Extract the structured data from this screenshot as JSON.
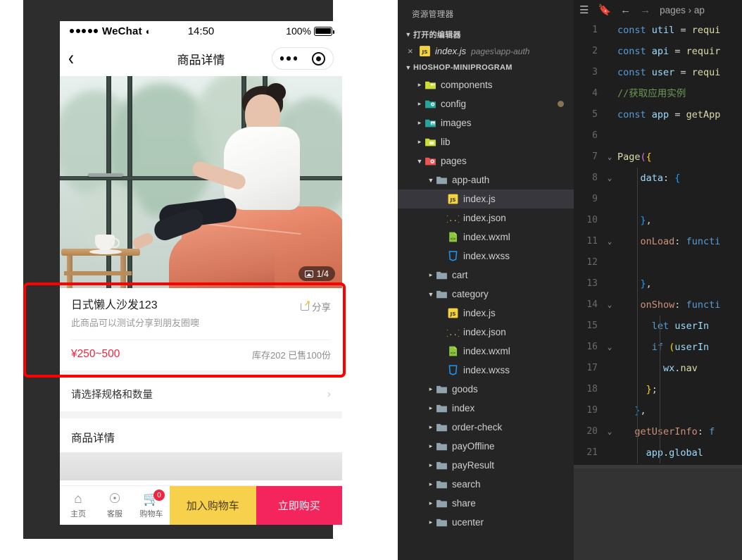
{
  "simulator": {
    "status_bar": {
      "carrier": "WeChat",
      "time": "14:50",
      "battery": "100%"
    },
    "nav": {
      "back_icon": "chevron-left-icon",
      "title": "商品详情",
      "more_icon": "more-dots-icon",
      "target_icon": "capsule-target-icon"
    },
    "hero": {
      "carousel_counter": "1/4"
    },
    "product": {
      "title": "日式懒人沙发123",
      "description": "此商品可以测试分享到朋友圈噢",
      "share_label": "分享",
      "price": "¥250~500",
      "stock": "库存202  已售100份",
      "price_color": "#f0253f"
    },
    "spec_row": {
      "label": "请选择规格和数量",
      "chevron": "›"
    },
    "detail_section": {
      "title": "商品详情"
    },
    "bottom_bar": {
      "items": [
        {
          "icon": "home-icon",
          "glyph": "⌂",
          "label": "主页"
        },
        {
          "icon": "service-chat-icon",
          "glyph": "☺",
          "label": "客服"
        },
        {
          "icon": "cart-icon",
          "glyph": "🛒",
          "label": "购物车",
          "badge": "0"
        }
      ],
      "add_cart_label": "加入购物车",
      "buy_now_label": "立即购买",
      "add_cart_color": "#f8d14c",
      "buy_now_color": "#f4255c"
    },
    "annotation": {
      "type": "red-rectangle",
      "color": "#fe0000"
    }
  },
  "explorer": {
    "title": "资源管理器",
    "open_editors": {
      "label": "打开的编辑器",
      "items": [
        {
          "close": "×",
          "icon": "js-file-icon",
          "name": "index.js",
          "path": "pages\\app-auth"
        }
      ]
    },
    "project": {
      "label": "HIOSHOP-MINIPROGRAM",
      "tree": [
        {
          "depth": 1,
          "type": "folder",
          "icon": "folder-components-icon",
          "name": "components",
          "expanded": false
        },
        {
          "depth": 1,
          "type": "folder",
          "icon": "folder-config-icon",
          "name": "config",
          "expanded": false,
          "dirty": true
        },
        {
          "depth": 1,
          "type": "folder",
          "icon": "folder-images-icon",
          "name": "images",
          "expanded": false
        },
        {
          "depth": 1,
          "type": "folder",
          "icon": "folder-lib-icon",
          "name": "lib",
          "expanded": false
        },
        {
          "depth": 1,
          "type": "folder",
          "icon": "folder-pages-icon",
          "name": "pages",
          "expanded": true
        },
        {
          "depth": 2,
          "type": "folder",
          "icon": "folder-icon",
          "name": "app-auth",
          "expanded": true
        },
        {
          "depth": 3,
          "type": "file",
          "icon": "js-file-icon",
          "name": "index.js",
          "selected": true
        },
        {
          "depth": 3,
          "type": "file",
          "icon": "json-file-icon",
          "name": "index.json"
        },
        {
          "depth": 3,
          "type": "file",
          "icon": "wxml-file-icon",
          "name": "index.wxml"
        },
        {
          "depth": 3,
          "type": "file",
          "icon": "wxss-file-icon",
          "name": "index.wxss"
        },
        {
          "depth": 2,
          "type": "folder",
          "icon": "folder-icon",
          "name": "cart",
          "expanded": false
        },
        {
          "depth": 2,
          "type": "folder",
          "icon": "folder-icon",
          "name": "category",
          "expanded": true
        },
        {
          "depth": 3,
          "type": "file",
          "icon": "js-file-icon",
          "name": "index.js"
        },
        {
          "depth": 3,
          "type": "file",
          "icon": "json-file-icon",
          "name": "index.json"
        },
        {
          "depth": 3,
          "type": "file",
          "icon": "wxml-file-icon",
          "name": "index.wxml"
        },
        {
          "depth": 3,
          "type": "file",
          "icon": "wxss-file-icon",
          "name": "index.wxss"
        },
        {
          "depth": 2,
          "type": "folder",
          "icon": "folder-icon",
          "name": "goods",
          "expanded": false
        },
        {
          "depth": 2,
          "type": "folder",
          "icon": "folder-icon",
          "name": "index",
          "expanded": false
        },
        {
          "depth": 2,
          "type": "folder",
          "icon": "folder-icon",
          "name": "order-check",
          "expanded": false
        },
        {
          "depth": 2,
          "type": "folder",
          "icon": "folder-icon",
          "name": "payOffline",
          "expanded": false
        },
        {
          "depth": 2,
          "type": "folder",
          "icon": "folder-icon",
          "name": "payResult",
          "expanded": false
        },
        {
          "depth": 2,
          "type": "folder",
          "icon": "folder-icon",
          "name": "search",
          "expanded": false
        },
        {
          "depth": 2,
          "type": "folder",
          "icon": "folder-icon",
          "name": "share",
          "expanded": false
        },
        {
          "depth": 2,
          "type": "folder",
          "icon": "folder-icon",
          "name": "ucenter",
          "expanded": false
        }
      ]
    }
  },
  "code_editor": {
    "breadcrumb": {
      "list_icon": "outline-list-icon",
      "bookmark_icon": "bookmark-icon",
      "back_icon": "arrow-left-icon",
      "forward_icon": "arrow-right-icon",
      "path": "pages › ap"
    },
    "lines": [
      {
        "n": "1",
        "fold": "",
        "html": "<span class='kw'>const</span> <span class='var'>util</span> <span class='op'>=</span> <span class='fn'>requi</span>"
      },
      {
        "n": "2",
        "fold": "",
        "html": "<span class='kw'>const</span> <span class='var'>api</span> <span class='op'>=</span> <span class='fn'>requir</span>"
      },
      {
        "n": "3",
        "fold": "",
        "html": "<span class='kw'>const</span> <span class='var'>user</span> <span class='op'>=</span> <span class='fn'>requi</span>"
      },
      {
        "n": "4",
        "fold": "",
        "html": "<span class='cm'>//获取应用实例</span>"
      },
      {
        "n": "5",
        "fold": "",
        "html": "<span class='kw'>const</span> <span class='var'>app</span> <span class='op'>=</span> <span class='fn'>getApp</span>"
      },
      {
        "n": "6",
        "fold": "",
        "html": ""
      },
      {
        "n": "7",
        "fold": "v",
        "html": "<span class='fn'>Page</span><span class='br2'>(</span><span class='br1'>{</span>"
      },
      {
        "n": "8",
        "fold": "v",
        "html": "    <span class='var'>data</span><span class='op'>: </span><span class='br3'>{</span>"
      },
      {
        "n": "9",
        "fold": "",
        "html": ""
      },
      {
        "n": "10",
        "fold": "",
        "html": "    <span class='br3'>}</span><span class='op'>,</span>"
      },
      {
        "n": "11",
        "fold": "v",
        "html": "    <span class='pr'>onLoad</span><span class='op'>: </span><span class='kw'>functi</span>"
      },
      {
        "n": "12",
        "fold": "",
        "html": ""
      },
      {
        "n": "13",
        "fold": "",
        "html": "    <span class='br3'>}</span><span class='op'>,</span>"
      },
      {
        "n": "14",
        "fold": "v",
        "html": "    <span class='pr'>onShow</span><span class='op'>: </span><span class='kw'>functi</span>"
      },
      {
        "n": "15",
        "fold": "",
        "html": "      <span class='kw'>let</span> <span class='var'>userIn</span>"
      },
      {
        "n": "16",
        "fold": "v",
        "html": "      <span class='kw'>if</span> <span class='br1'>(</span><span class='var'>userIn</span>"
      },
      {
        "n": "17",
        "fold": "",
        "html": "        <span class='var'>wx</span><span class='op'>.</span><span class='fn'>nav</span>"
      },
      {
        "n": "18",
        "fold": "",
        "html": "     <span class='br1'>}</span><span class='op'>;</span>"
      },
      {
        "n": "19",
        "fold": "",
        "html": "   <span class='br3'>}</span><span class='op'>,</span>"
      },
      {
        "n": "20",
        "fold": "v",
        "html": "   <span class='pr'>getUserInfo</span><span class='op'>: </span><span class='kw'>f</span>"
      },
      {
        "n": "21",
        "fold": "",
        "html": "     <span class='var'>app</span><span class='op'>.</span><span class='var'>global</span>"
      }
    ]
  }
}
